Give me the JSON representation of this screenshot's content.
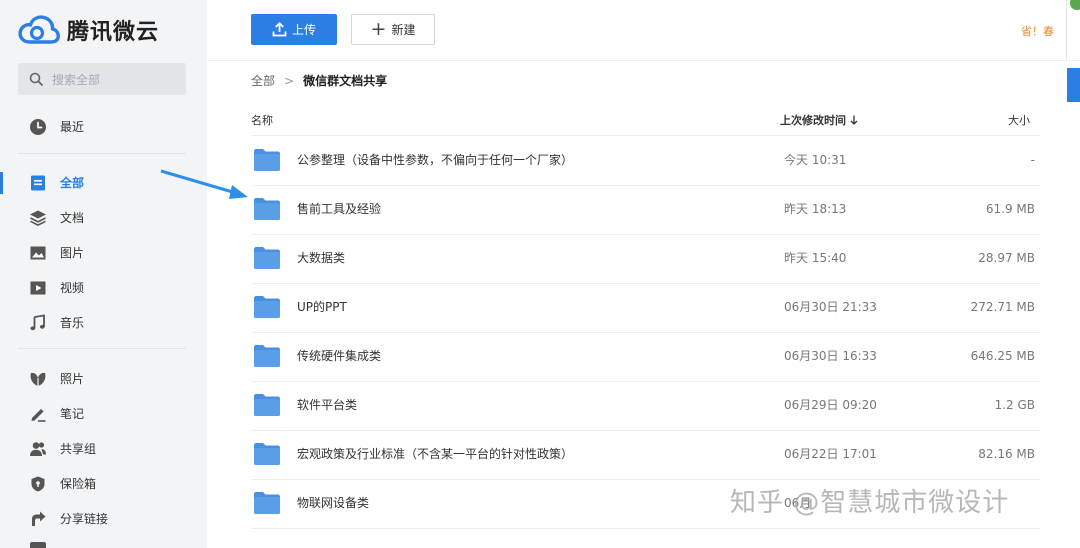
{
  "app": {
    "name": "腾讯微云"
  },
  "search": {
    "placeholder": "搜索全部"
  },
  "nav": {
    "items": [
      {
        "label": "最近",
        "icon": "clock-icon"
      },
      {
        "label": "全部",
        "icon": "document-icon",
        "active": true
      },
      {
        "label": "文档",
        "icon": "layers-icon"
      },
      {
        "label": "图片",
        "icon": "image-icon"
      },
      {
        "label": "视频",
        "icon": "play-icon"
      },
      {
        "label": "音乐",
        "icon": "music-icon"
      },
      {
        "label": "照片",
        "icon": "photo-leaf-icon"
      },
      {
        "label": "笔记",
        "icon": "pen-icon"
      },
      {
        "label": "共享组",
        "icon": "users-icon"
      },
      {
        "label": "保险箱",
        "icon": "shield-icon"
      },
      {
        "label": "分享链接",
        "icon": "share-icon"
      }
    ]
  },
  "toolbar": {
    "upload_label": "上传",
    "new_label": "新建",
    "promo": "省！春"
  },
  "breadcrumb": {
    "root": "全部",
    "separator": ">",
    "current": "微信群文档共享"
  },
  "table": {
    "columns": {
      "name": "名称",
      "time": "上次修改时间",
      "size": "大小"
    },
    "rows": [
      {
        "name": "公参整理（设备中性参数，不偏向于任何一个厂家）",
        "time": "今天 10:31",
        "size": "-"
      },
      {
        "name": "售前工具及经验",
        "time": "昨天 18:13",
        "size": "61.9 MB"
      },
      {
        "name": "大数据类",
        "time": "昨天 15:40",
        "size": "28.97 MB"
      },
      {
        "name": "UP的PPT",
        "time": "06月30日 21:33",
        "size": "272.71 MB"
      },
      {
        "name": "传统硬件集成类",
        "time": "06月30日 16:33",
        "size": "646.25 MB"
      },
      {
        "name": "软件平台类",
        "time": "06月29日 09:20",
        "size": "1.2 GB"
      },
      {
        "name": "宏观政策及行业标准（不含某一平台的针对性政策）",
        "time": "06月22日 17:01",
        "size": "82.16 MB"
      },
      {
        "name": "物联网设备类",
        "time": "06月",
        "size": ""
      }
    ]
  },
  "watermark": "知乎 @智慧城市微设计",
  "colors": {
    "accent": "#2b7fe3",
    "folder": "#4a90e2",
    "sidebar_bg": "#f3f4f6",
    "promo": "#e8892f"
  }
}
